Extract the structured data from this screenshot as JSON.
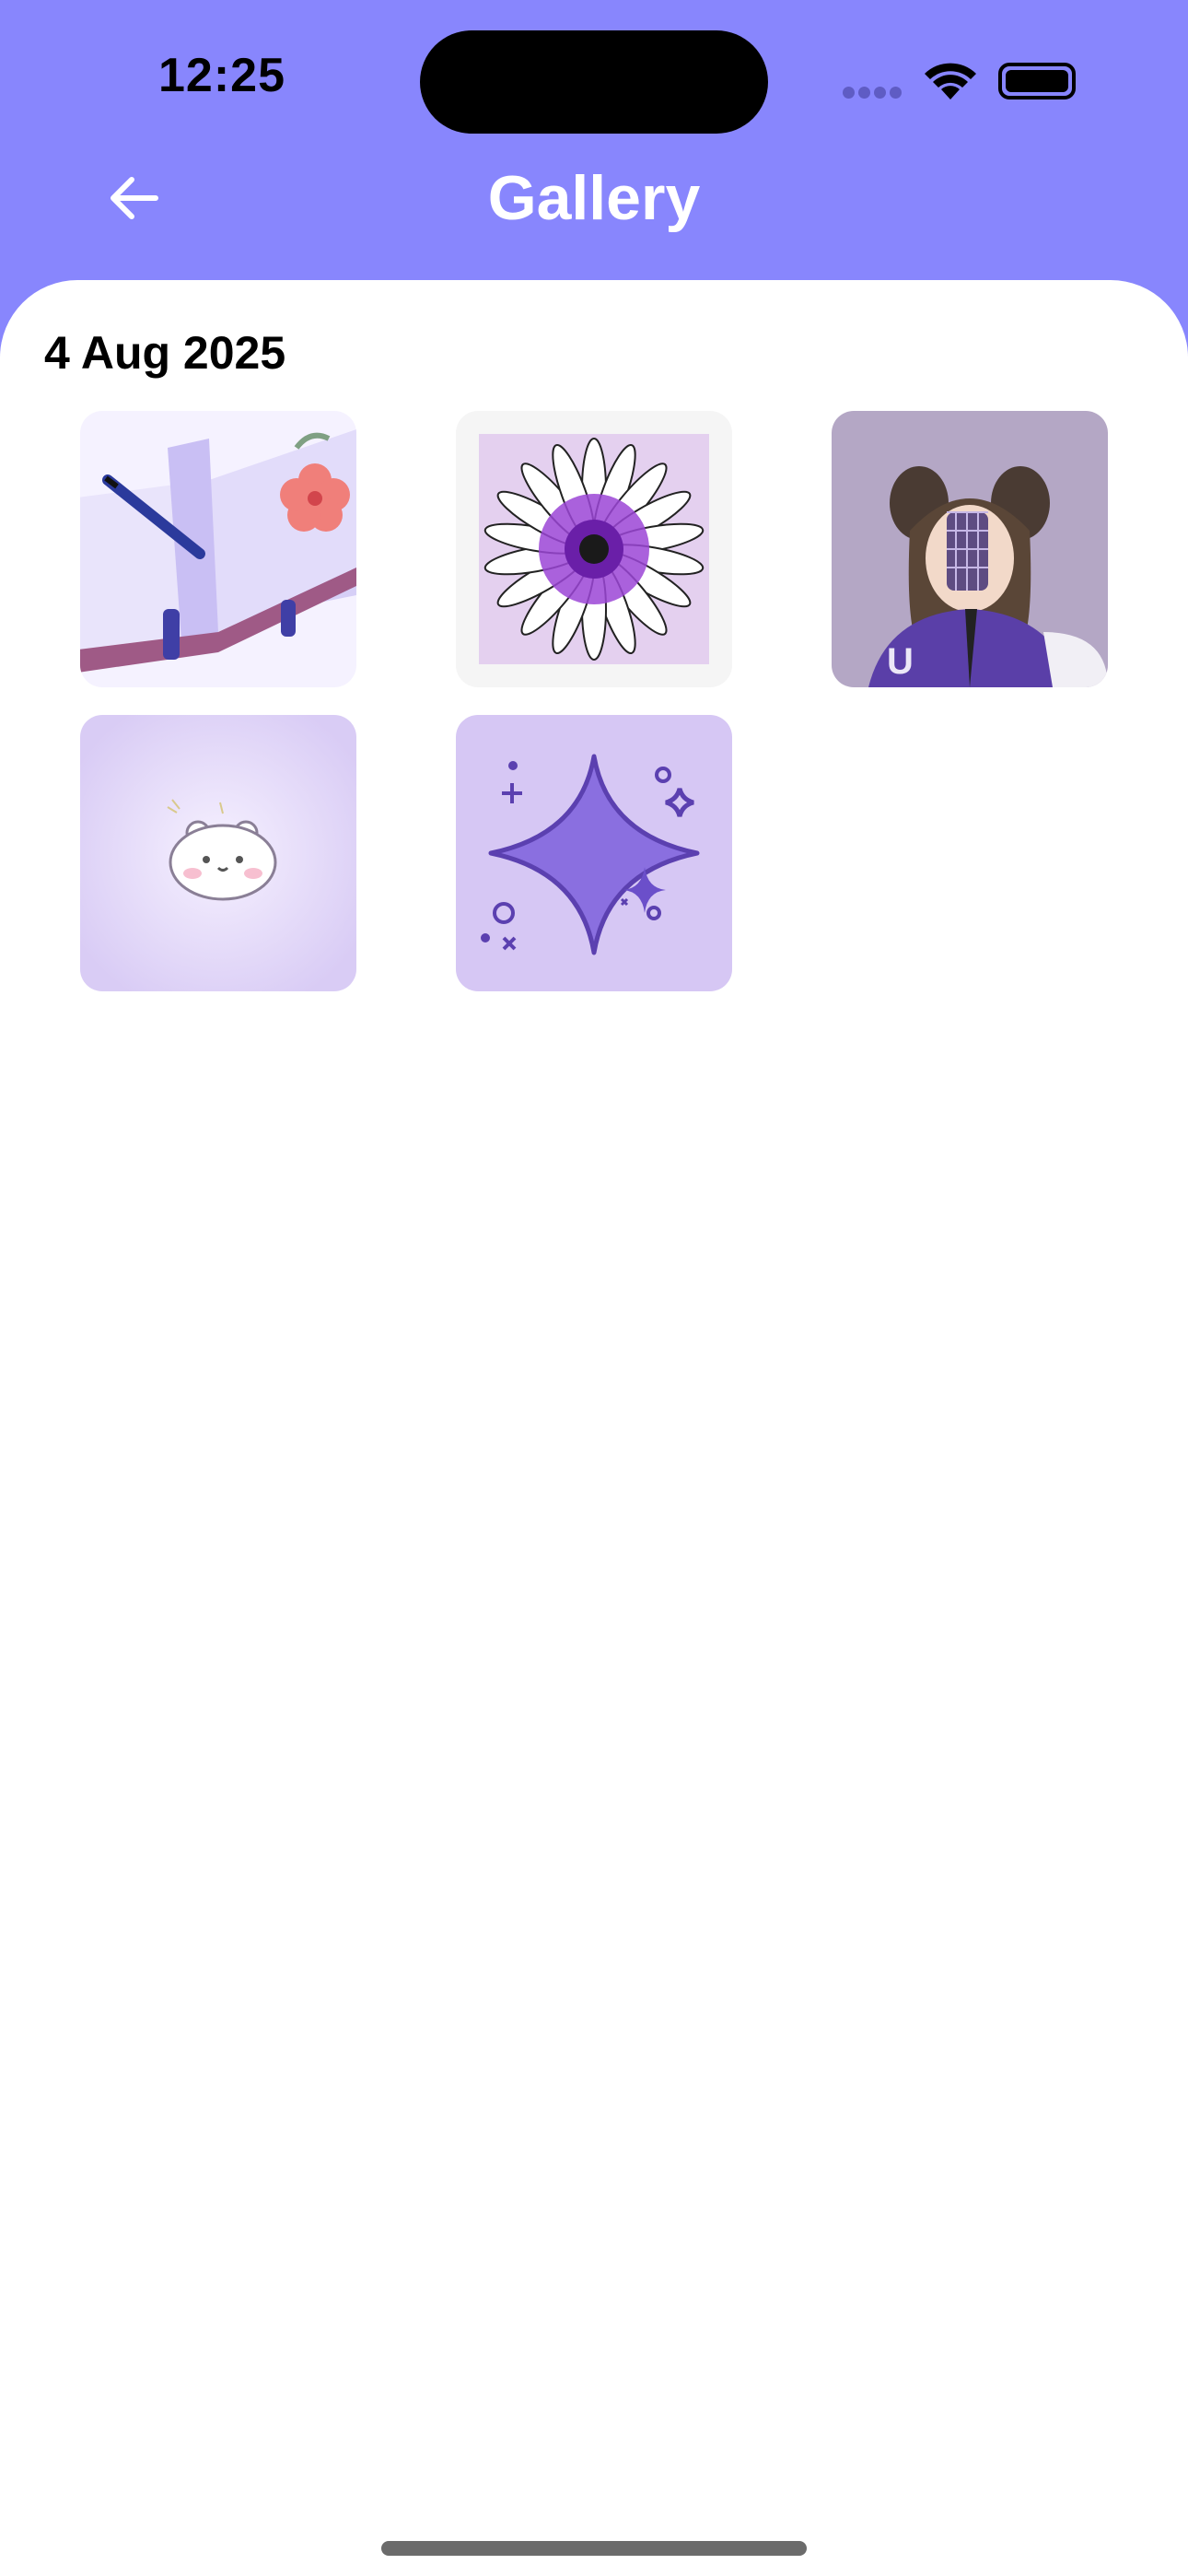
{
  "status_bar": {
    "time": "12:25",
    "icons": [
      "signal-dots-icon",
      "wifi-icon",
      "battery-icon"
    ]
  },
  "header": {
    "title": "Gallery",
    "back_icon": "arrow-left-icon",
    "background_color": "#8886fd"
  },
  "gallery": {
    "section_date": "4 Aug 2025",
    "items": [
      {
        "name": "open-notebook-flower-image",
        "bg": "#f5f2ff"
      },
      {
        "name": "purple-daisy-image",
        "bg": "#f5f5f5"
      },
      {
        "name": "girl-selfie-image",
        "bg": "#b4a7c5"
      },
      {
        "name": "cute-bear-image",
        "bg": "#e6dcf7"
      },
      {
        "name": "purple-sparkle-image",
        "bg": "#d6c7f4"
      }
    ]
  }
}
